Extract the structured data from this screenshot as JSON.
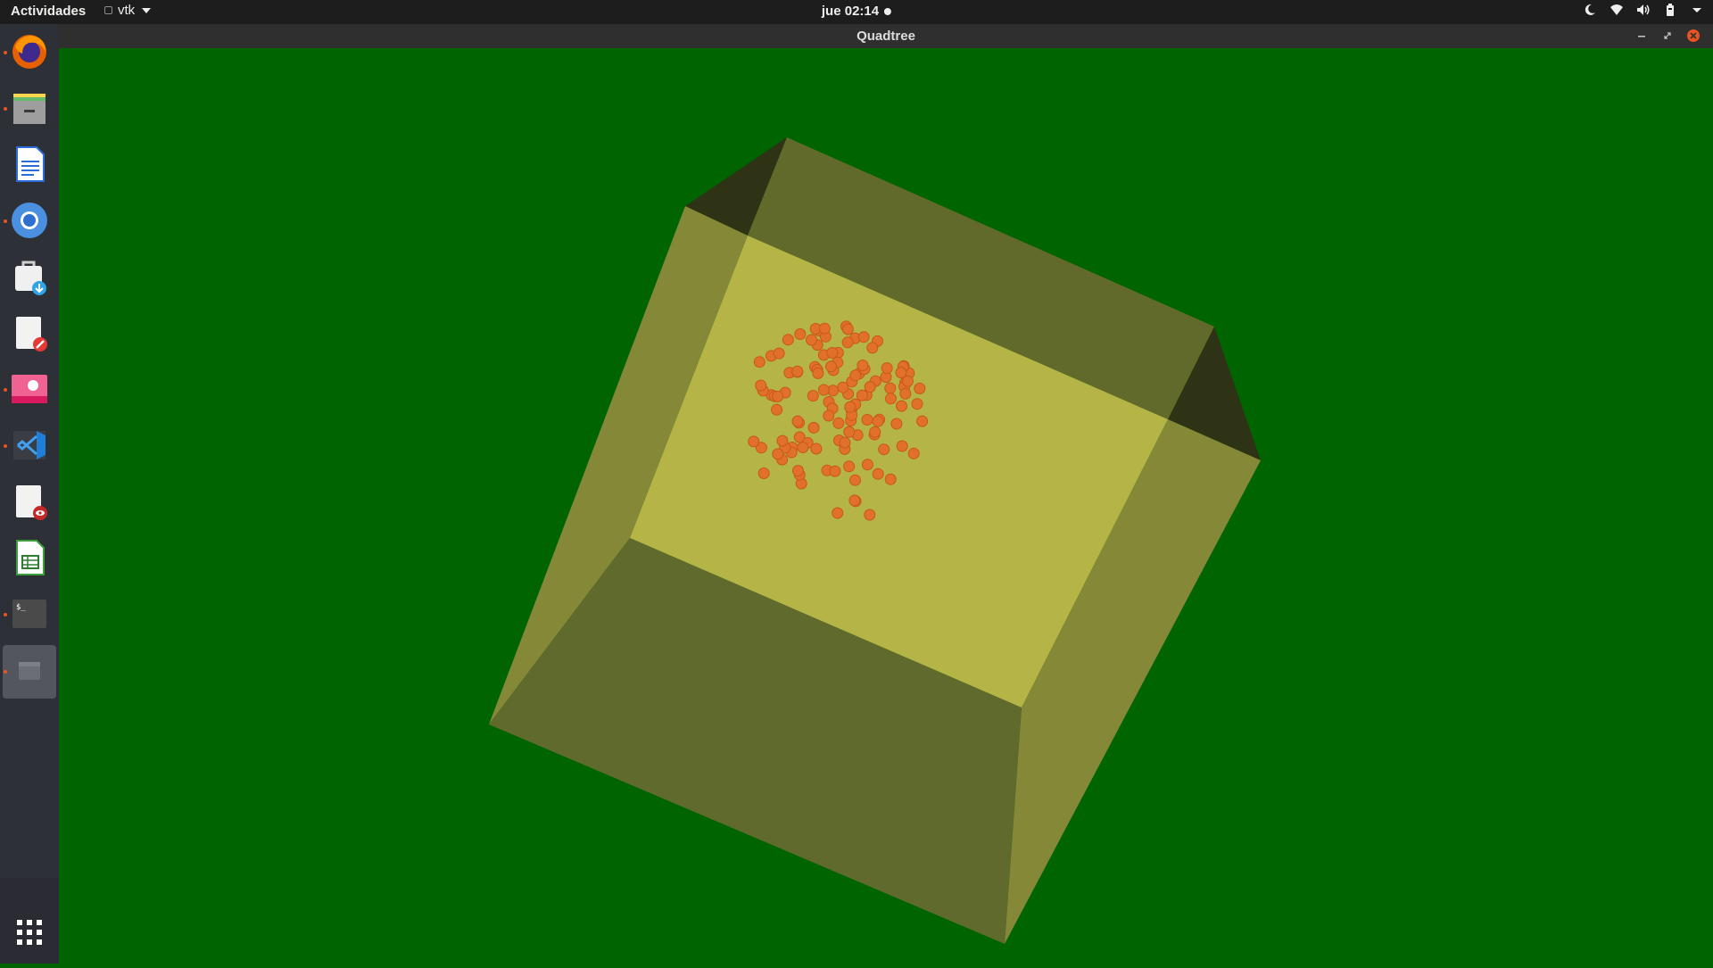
{
  "topbar": {
    "activities_label": "Actividades",
    "app_menu_label": "vtk",
    "clock": "jue 02:14",
    "tray_icons": [
      "night-light-icon",
      "wifi-icon",
      "volume-icon",
      "battery-icon",
      "system-menu-caret-icon"
    ]
  },
  "dock": {
    "items": [
      {
        "name": "firefox",
        "running": true
      },
      {
        "name": "files",
        "running": true
      },
      {
        "name": "libreoffice-writer",
        "running": false
      },
      {
        "name": "chromium",
        "running": true
      },
      {
        "name": "software-updater",
        "running": false
      },
      {
        "name": "text-editor",
        "running": false
      },
      {
        "name": "image-viewer",
        "running": true
      },
      {
        "name": "vscode",
        "running": true
      },
      {
        "name": "document-viewer",
        "running": false
      },
      {
        "name": "libreoffice-calc",
        "running": false
      },
      {
        "name": "terminal",
        "running": true
      },
      {
        "name": "vtk-window",
        "running": true,
        "active": true
      }
    ],
    "show_apps_icon": "app-grid-icon"
  },
  "window": {
    "title": "Quadtree",
    "background_color": "#006400",
    "box_face_color": "#b4b447",
    "point_color": "#e0702a"
  }
}
